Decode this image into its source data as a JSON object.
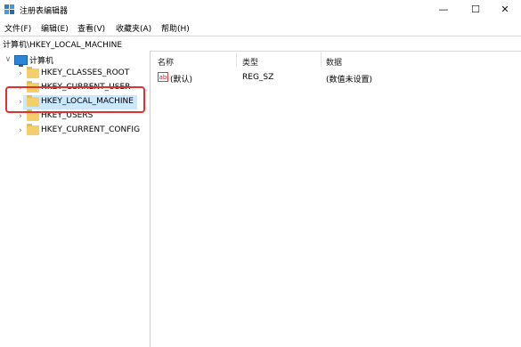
{
  "window": {
    "title": "注册表编辑器",
    "minimize": "—",
    "maximize": "☐",
    "close": "✕"
  },
  "menu": [
    "文件(F)",
    "编辑(E)",
    "查看(V)",
    "收藏夹(A)",
    "帮助(H)"
  ],
  "address": "计算机\\HKEY_LOCAL_MACHINE",
  "tree": {
    "root": "计算机",
    "items": [
      {
        "label": "HKEY_CLASSES_ROOT"
      },
      {
        "label": "HKEY_CURRENT_USER"
      },
      {
        "label": "HKEY_LOCAL_MACHINE"
      },
      {
        "label": "HKEY_USERS"
      },
      {
        "label": "HKEY_CURRENT_CONFIG"
      }
    ]
  },
  "list": {
    "columns": [
      "名称",
      "类型",
      "数据"
    ],
    "rows": [
      {
        "icon": "ab",
        "name": "(默认)",
        "type": "REG_SZ",
        "data": "(数值未设置)"
      }
    ]
  }
}
